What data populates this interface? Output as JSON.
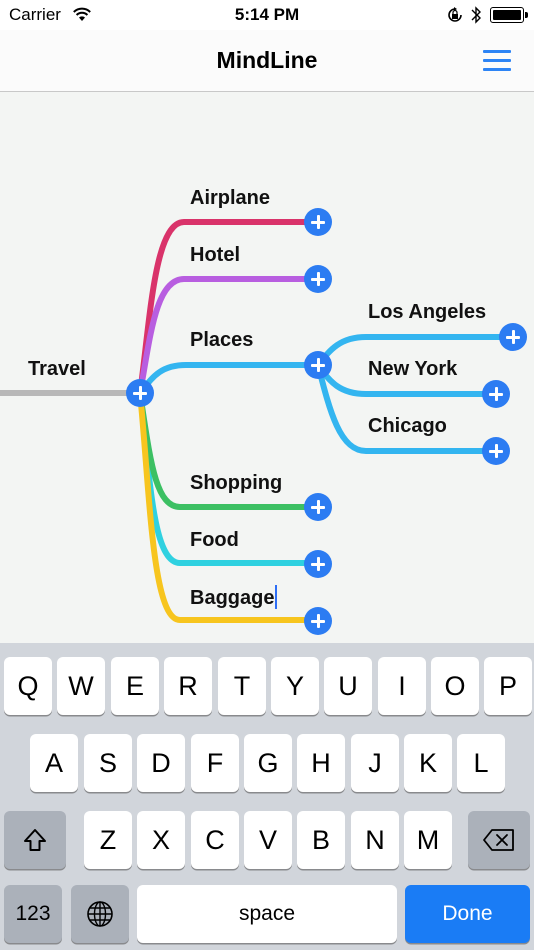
{
  "status_bar": {
    "carrier": "Carrier",
    "time": "5:14 PM"
  },
  "nav": {
    "title": "MindLine",
    "menu_icon": "hamburger-menu-icon"
  },
  "mindmap": {
    "root": {
      "label": "Travel",
      "line_color": "#b8b8b8"
    },
    "branches": [
      {
        "label": "Airplane",
        "color": "#d9336a"
      },
      {
        "label": "Hotel",
        "color": "#b85ee0"
      },
      {
        "label": "Places",
        "color": "#33b5f0",
        "children": [
          {
            "label": "Los Angeles",
            "color": "#33b5f0"
          },
          {
            "label": "New York",
            "color": "#33b5f0"
          },
          {
            "label": "Chicago",
            "color": "#33b5f0"
          }
        ]
      },
      {
        "label": "Shopping",
        "color": "#3cc063"
      },
      {
        "label": "Food",
        "color": "#2fd1e0"
      },
      {
        "label": "Baggage",
        "color": "#f7c51e",
        "editing": true
      }
    ],
    "add_button_color": "#2c7cf2"
  },
  "keyboard": {
    "row1": [
      "Q",
      "W",
      "E",
      "R",
      "T",
      "Y",
      "U",
      "I",
      "O",
      "P"
    ],
    "row2": [
      "A",
      "S",
      "D",
      "F",
      "G",
      "H",
      "J",
      "K",
      "L"
    ],
    "row3": [
      "Z",
      "X",
      "C",
      "V",
      "B",
      "N",
      "M"
    ],
    "shift_icon": "shift-icon",
    "backspace_icon": "backspace-icon",
    "numbers_label": "123",
    "globe_icon": "globe-icon",
    "space_label": "space",
    "done_label": "Done",
    "accent_color": "#1a7cf5"
  }
}
